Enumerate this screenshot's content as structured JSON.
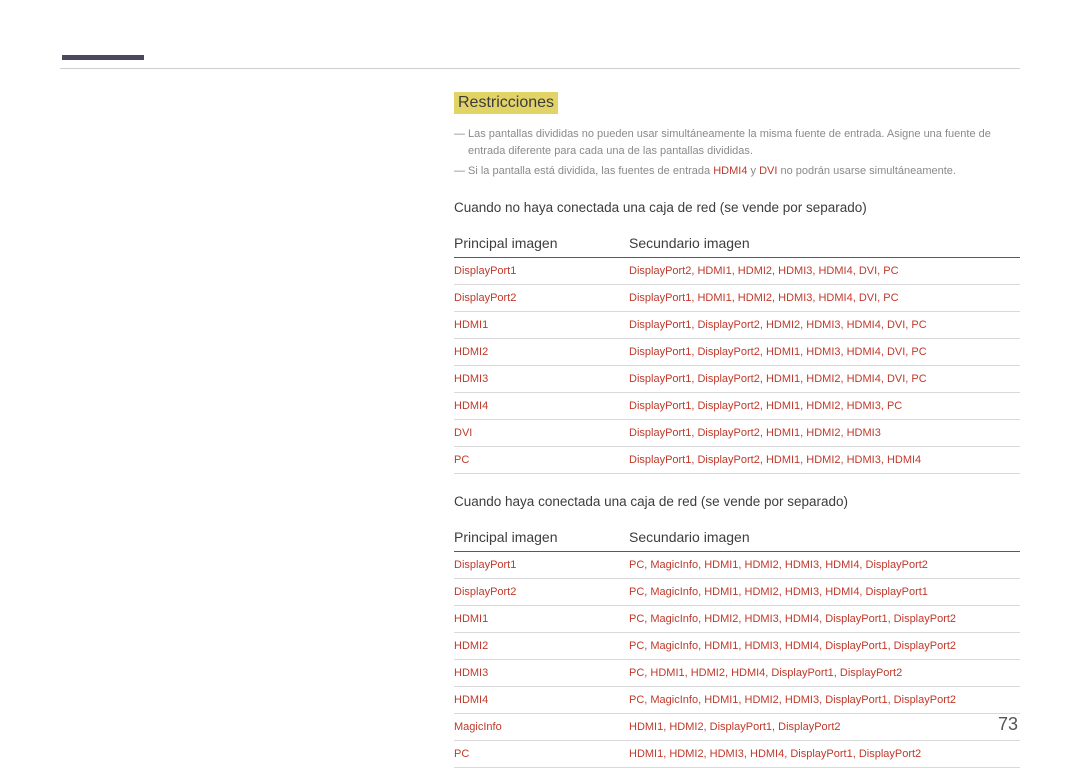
{
  "heading": "Restricciones",
  "notes": [
    {
      "pre": "Las pantallas divididas no pueden usar simultáneamente la misma fuente de entrada. Asigne una fuente de entrada diferente para cada una de las pantallas divididas.",
      "srcs": []
    },
    {
      "pre": "Si la pantalla está dividida, las fuentes de entrada ",
      "srcs": [
        "HDMI4",
        "DVI"
      ],
      "mid": " y ",
      "post": " no podrán usarse simultáneamente."
    }
  ],
  "section1": {
    "caption": "Cuando no haya conectada una caja de red (se vende por separado)",
    "col1": "Principal imagen",
    "col2": "Secundario imagen",
    "rows": [
      {
        "p": "DisplayPort1",
        "s": "DisplayPort2, HDMI1, HDMI2, HDMI3, HDMI4, DVI, PC"
      },
      {
        "p": "DisplayPort2",
        "s": "DisplayPort1, HDMI1, HDMI2, HDMI3, HDMI4, DVI, PC"
      },
      {
        "p": "HDMI1",
        "s": "DisplayPort1, DisplayPort2, HDMI2, HDMI3, HDMI4, DVI, PC"
      },
      {
        "p": "HDMI2",
        "s": "DisplayPort1, DisplayPort2, HDMI1, HDMI3, HDMI4, DVI, PC"
      },
      {
        "p": "HDMI3",
        "s": "DisplayPort1, DisplayPort2, HDMI1, HDMI2, HDMI4, DVI, PC"
      },
      {
        "p": "HDMI4",
        "s": "DisplayPort1, DisplayPort2, HDMI1, HDMI2, HDMI3, PC"
      },
      {
        "p": "DVI",
        "s": "DisplayPort1, DisplayPort2, HDMI1, HDMI2, HDMI3"
      },
      {
        "p": "PC",
        "s": "DisplayPort1, DisplayPort2, HDMI1, HDMI2, HDMI3, HDMI4"
      }
    ]
  },
  "section2": {
    "caption": "Cuando haya conectada una caja de red (se vende por separado)",
    "col1": "Principal imagen",
    "col2": "Secundario imagen",
    "rows": [
      {
        "p": "DisplayPort1",
        "s": "PC, MagicInfo, HDMI1, HDMI2, HDMI3, HDMI4, DisplayPort2"
      },
      {
        "p": "DisplayPort2",
        "s": "PC, MagicInfo, HDMI1, HDMI2, HDMI3, HDMI4, DisplayPort1"
      },
      {
        "p": "HDMI1",
        "s": "PC, MagicInfo, HDMI2, HDMI3, HDMI4, DisplayPort1, DisplayPort2"
      },
      {
        "p": "HDMI2",
        "s": "PC, MagicInfo, HDMI1, HDMI3, HDMI4, DisplayPort1, DisplayPort2"
      },
      {
        "p": "HDMI3",
        "s": "PC, HDMI1, HDMI2, HDMI4, DisplayPort1, DisplayPort2"
      },
      {
        "p": "HDMI4",
        "s": "PC, MagicInfo, HDMI1, HDMI2, HDMI3, DisplayPort1, DisplayPort2"
      },
      {
        "p": "MagicInfo",
        "s": "HDMI1, HDMI2, DisplayPort1, DisplayPort2"
      },
      {
        "p": "PC",
        "s": "HDMI1, HDMI2, HDMI3, HDMI4, DisplayPort1, DisplayPort2"
      }
    ]
  },
  "pageNumber": "73"
}
